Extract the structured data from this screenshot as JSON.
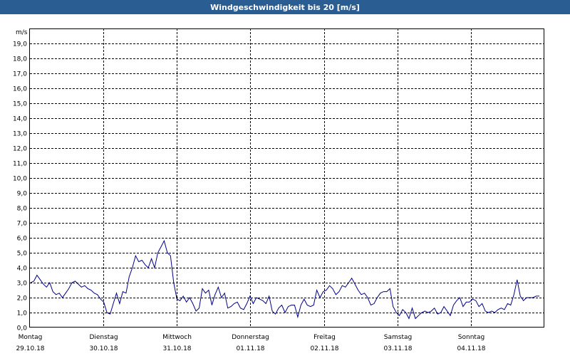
{
  "title": "Windgeschwindigkeit bis 20 [m/s]",
  "chart_data": {
    "type": "line",
    "title": "Windgeschwindigkeit bis 20 [m/s]",
    "ylabel": "m/s",
    "ylim": [
      0,
      20
    ],
    "yticks": [
      "0,0",
      "1,0",
      "2,0",
      "3,0",
      "4,0",
      "5,0",
      "6,0",
      "7,0",
      "8,0",
      "9,0",
      "10,0",
      "11,0",
      "12,0",
      "13,0",
      "14,0",
      "15,0",
      "16,0",
      "17,0",
      "18,0",
      "19,0"
    ],
    "xlim": [
      0,
      7
    ],
    "grid": true,
    "days": [
      {
        "day": "Montag",
        "date": "29.10.18"
      },
      {
        "day": "Dienstag",
        "date": "30.10.18"
      },
      {
        "day": "Mittwoch",
        "date": "31.10.18"
      },
      {
        "day": "Donnerstag",
        "date": "01.11.18"
      },
      {
        "day": "Freitag",
        "date": "02.11.18"
      },
      {
        "day": "Samstag",
        "date": "03.11.18"
      },
      {
        "day": "Sonntag",
        "date": "04.11.18"
      }
    ],
    "series": [
      {
        "values": [
          3.0,
          3.1,
          3.5,
          3.2,
          2.9,
          2.7,
          3.0,
          2.4,
          2.2,
          2.3,
          2.0,
          2.3,
          2.6,
          3.0,
          3.1,
          2.9,
          2.7,
          2.8,
          2.6,
          2.5,
          2.3,
          2.2,
          1.9,
          1.7,
          1.0,
          0.9,
          1.6,
          2.3,
          1.6,
          2.4,
          2.3,
          3.4,
          4.0,
          4.8,
          4.4,
          4.5,
          4.2,
          4.0,
          4.6,
          4.0,
          5.0,
          5.4,
          5.8,
          5.0,
          4.8,
          3.0,
          1.9,
          1.8,
          2.1,
          1.7,
          2.0,
          1.6,
          1.1,
          1.3,
          2.6,
          2.3,
          2.5,
          1.5,
          2.2,
          2.7,
          2.0,
          2.3,
          1.3,
          1.4,
          1.6,
          1.7,
          1.3,
          1.2,
          1.6,
          2.1,
          1.6,
          2.0,
          1.9,
          1.8,
          1.6,
          2.1,
          1.1,
          0.9,
          1.3,
          1.5,
          1.0,
          1.4,
          1.5,
          1.5,
          0.7,
          1.5,
          1.9,
          1.5,
          1.4,
          1.5,
          2.5,
          2.0,
          2.4,
          2.5,
          2.8,
          2.6,
          2.2,
          2.4,
          2.8,
          2.7,
          3.0,
          3.3,
          2.9,
          2.5,
          2.2,
          2.3,
          2.0,
          1.5,
          1.6,
          2.0,
          2.3,
          2.4,
          2.4,
          2.6,
          1.4,
          1.0,
          0.8,
          1.2,
          1.0,
          0.6,
          1.3,
          0.6,
          0.8,
          1.0,
          1.1,
          1.0,
          1.1,
          1.3,
          0.9,
          1.0,
          1.4,
          1.1,
          0.8,
          1.5,
          1.8,
          2.0,
          1.4,
          1.7,
          1.7,
          1.9,
          1.8,
          1.4,
          1.6,
          1.1,
          1.0,
          1.1,
          1.0,
          1.2,
          1.3,
          1.2,
          1.6,
          1.5,
          2.2,
          3.2,
          2.1,
          1.8,
          2.0,
          2.0,
          2.0,
          2.1,
          2.1
        ]
      }
    ]
  }
}
